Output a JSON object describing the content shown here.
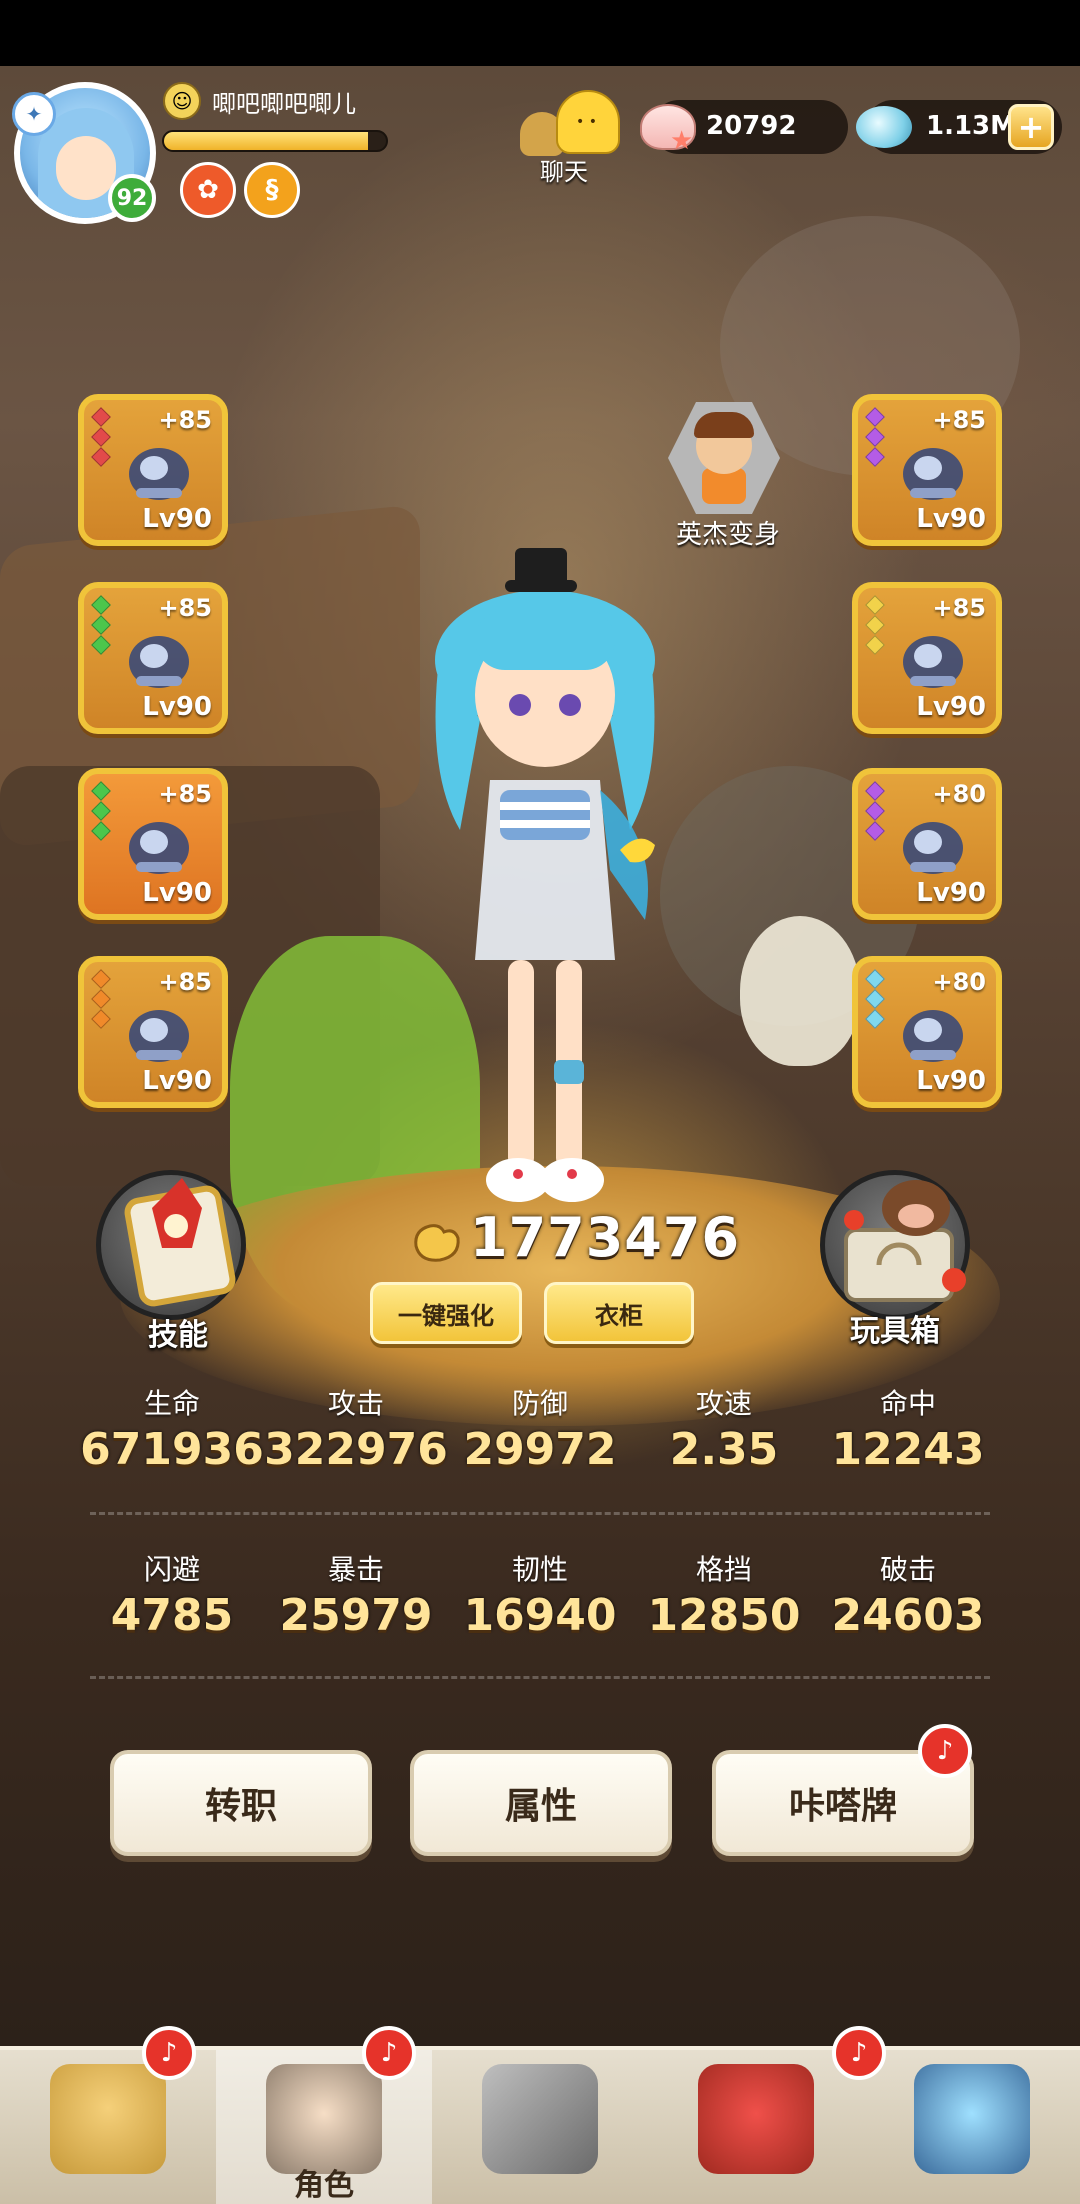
{
  "player": {
    "name": "唧吧唧吧唧儿",
    "level": "92",
    "exp_fraction": 0.92
  },
  "chat": {
    "label": "聊天"
  },
  "resources": {
    "shells": "20792",
    "crystals": "1.13M",
    "add_label": "+"
  },
  "equipment": {
    "left": [
      {
        "plus": "+85",
        "level": "Lv90",
        "gem_color": "#e24a4a",
        "icon": "armored-beast-icon"
      },
      {
        "plus": "+85",
        "level": "Lv90",
        "gem_color": "#4cc64c",
        "icon": "dragon-glider-icon"
      },
      {
        "plus": "+85",
        "level": "Lv90",
        "gem_color": "#4cc64c",
        "icon": "gauntlet-icon"
      },
      {
        "plus": "+85",
        "level": "Lv90",
        "gem_color": "#f08a2a",
        "icon": "ring-icon"
      }
    ],
    "right": [
      {
        "plus": "+85",
        "level": "Lv90",
        "gem_color": "#b45ce6",
        "icon": "orb-icon"
      },
      {
        "plus": "+85",
        "level": "Lv90",
        "gem_color": "#f2d24a",
        "icon": "suit-icon"
      },
      {
        "plus": "+80",
        "level": "Lv90",
        "gem_color": "#b45ce6",
        "icon": "boot-icon"
      },
      {
        "plus": "+80",
        "level": "Lv90",
        "gem_color": "#7fd8ef",
        "icon": "necklace-icon"
      }
    ]
  },
  "hero_transform": {
    "label": "英杰变身"
  },
  "skill": {
    "label": "技能"
  },
  "toybox": {
    "label": "玩具箱"
  },
  "power": {
    "value": "1773476"
  },
  "actions": {
    "enhance_all": "一键强化",
    "wardrobe": "衣柜"
  },
  "stats_row1": [
    {
      "name": "生命",
      "value": "671936"
    },
    {
      "name": "攻击",
      "value": "322976"
    },
    {
      "name": "防御",
      "value": "29972"
    },
    {
      "name": "攻速",
      "value": "2.35"
    },
    {
      "name": "命中",
      "value": "12243"
    }
  ],
  "stats_row2": [
    {
      "name": "闪避",
      "value": "4785"
    },
    {
      "name": "暴击",
      "value": "25979"
    },
    {
      "name": "韧性",
      "value": "16940"
    },
    {
      "name": "格挡",
      "value": "12850"
    },
    {
      "name": "破击",
      "value": "24603"
    }
  ],
  "menu": {
    "job_change": "转职",
    "attributes": "属性",
    "kata_card": "咔嗒牌"
  },
  "nav": [
    {
      "label": "",
      "icon": "caveman-icon"
    },
    {
      "label": "角色",
      "icon": "character-icon"
    },
    {
      "label": "",
      "icon": "weapon-icon"
    },
    {
      "label": "",
      "icon": "pet-dino-icon"
    },
    {
      "label": "",
      "icon": "portal-icon"
    }
  ]
}
